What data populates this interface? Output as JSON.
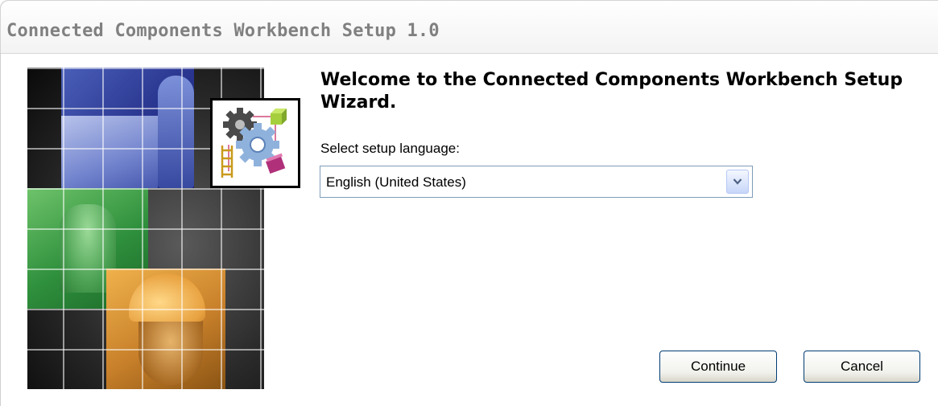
{
  "window": {
    "title": "Connected Components Workbench Setup 1.0"
  },
  "content": {
    "welcome_heading": "Welcome to the Connected Components Workbench Setup Wizard.",
    "language_label": "Select setup language:",
    "language_select": {
      "selected": "English (United States)"
    }
  },
  "buttons": {
    "continue_label": "Continue",
    "cancel_label": "Cancel"
  },
  "icons": {
    "dropdown": "chevron-down-icon",
    "product_logo": "gears-ladder-logo-icon"
  },
  "colors": {
    "title_text": "#808080",
    "button_border": "#003c74",
    "select_border": "#7f9db9"
  }
}
